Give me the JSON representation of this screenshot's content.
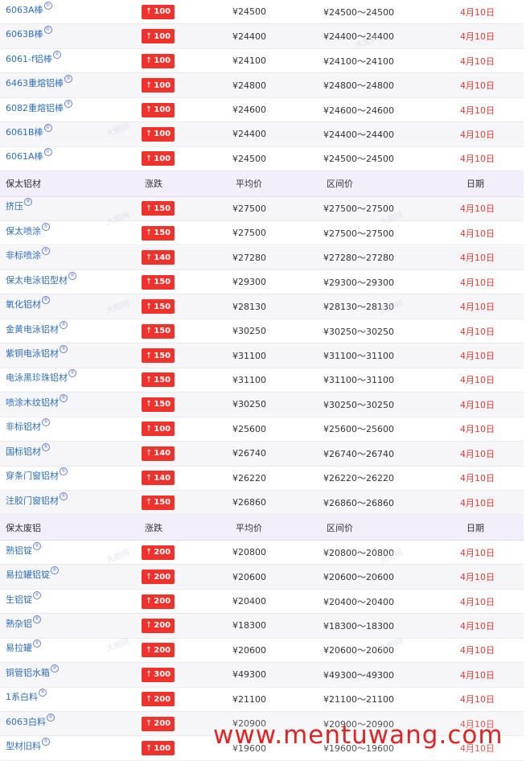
{
  "sections": [
    {
      "header": null,
      "rows": [
        {
          "name": "6063A棒",
          "change": "100",
          "avg": "¥24500",
          "range": "¥24500～24500",
          "date": "4月10日"
        },
        {
          "name": "6063B棒",
          "change": "100",
          "avg": "¥24400",
          "range": "¥24400～24400",
          "date": "4月10日"
        },
        {
          "name": "6061-f铝棒",
          "change": "100",
          "avg": "¥24100",
          "range": "¥24100～24100",
          "date": "4月10日"
        },
        {
          "name": "6463重熔铝棒",
          "change": "100",
          "avg": "¥24800",
          "range": "¥24800～24800",
          "date": "4月10日"
        },
        {
          "name": "6082重熔铝棒",
          "change": "100",
          "avg": "¥24600",
          "range": "¥24600～24600",
          "date": "4月10日"
        },
        {
          "name": "6061B棒",
          "change": "100",
          "avg": "¥24400",
          "range": "¥24400～24400",
          "date": "4月10日"
        },
        {
          "name": "6061A棒",
          "change": "100",
          "avg": "¥24500",
          "range": "¥24500～24500",
          "date": "4月10日"
        }
      ]
    },
    {
      "header": {
        "name": "保太铝材",
        "change": "涨跌",
        "avg": "平均价",
        "range": "区间价",
        "date": "日期"
      },
      "rows": [
        {
          "name": "挤压",
          "change": "150",
          "avg": "¥27500",
          "range": "¥27500～27500",
          "date": "4月10日"
        },
        {
          "name": "保太喷涂",
          "change": "150",
          "avg": "¥27500",
          "range": "¥27500～27500",
          "date": "4月10日"
        },
        {
          "name": "非标喷涂",
          "change": "140",
          "avg": "¥27280",
          "range": "¥27280～27280",
          "date": "4月10日"
        },
        {
          "name": "保太电泳铝型材",
          "change": "150",
          "avg": "¥29300",
          "range": "¥29300～29300",
          "date": "4月10日"
        },
        {
          "name": "氧化铝材",
          "change": "150",
          "avg": "¥28130",
          "range": "¥28130～28130",
          "date": "4月10日"
        },
        {
          "name": "金黄电泳铝材",
          "change": "150",
          "avg": "¥30250",
          "range": "¥30250～30250",
          "date": "4月10日"
        },
        {
          "name": "紫铜电泳铝材",
          "change": "150",
          "avg": "¥31100",
          "range": "¥31100～31100",
          "date": "4月10日"
        },
        {
          "name": "电泳黑珍珠铝材",
          "change": "150",
          "avg": "¥31100",
          "range": "¥31100～31100",
          "date": "4月10日"
        },
        {
          "name": "喷涂木纹铝材",
          "change": "150",
          "avg": "¥30250",
          "range": "¥30250～30250",
          "date": "4月10日"
        },
        {
          "name": "非标铝材",
          "change": "100",
          "avg": "¥25600",
          "range": "¥25600～25600",
          "date": "4月10日"
        },
        {
          "name": "国标铝材",
          "change": "140",
          "avg": "¥26740",
          "range": "¥26740～26740",
          "date": "4月10日"
        },
        {
          "name": "穿条门窗铝材",
          "change": "140",
          "avg": "¥26220",
          "range": "¥26220～26220",
          "date": "4月10日"
        },
        {
          "name": "注胶门窗铝材",
          "change": "150",
          "avg": "¥26860",
          "range": "¥26860～26860",
          "date": "4月10日"
        }
      ]
    },
    {
      "header": {
        "name": "保太废铝",
        "change": "涨跌",
        "avg": "平均价",
        "range": "区间价",
        "date": "日期"
      },
      "rows": [
        {
          "name": "熟铝锭",
          "change": "200",
          "avg": "¥20800",
          "range": "¥20800～20800",
          "date": "4月10日"
        },
        {
          "name": "易拉罐铝锭",
          "change": "200",
          "avg": "¥20600",
          "range": "¥20600～20600",
          "date": "4月10日"
        },
        {
          "name": "生铝锭",
          "change": "200",
          "avg": "¥20400",
          "range": "¥20400～20400",
          "date": "4月10日"
        },
        {
          "name": "熟杂铝",
          "change": "200",
          "avg": "¥18300",
          "range": "¥18300～18300",
          "date": "4月10日"
        },
        {
          "name": "易拉罐",
          "change": "200",
          "avg": "¥20600",
          "range": "¥20600～20600",
          "date": "4月10日"
        },
        {
          "name": "铜管铝水箱",
          "change": "300",
          "avg": "¥49300",
          "range": "¥49300～49300",
          "date": "4月10日"
        },
        {
          "name": "1系白料",
          "change": "200",
          "avg": "¥21100",
          "range": "¥21100～21100",
          "date": "4月10日"
        },
        {
          "name": "6063白料",
          "change": "200",
          "avg": "¥20900",
          "range": "¥20900～20900",
          "date": "4月10日"
        },
        {
          "name": "型材旧料",
          "change": "100",
          "avg": "¥19600",
          "range": "¥19600～19600",
          "date": "4月10日"
        }
      ]
    }
  ],
  "watermark_text": "大胆网",
  "footer_watermark": "www.mentuwang.com",
  "icons": {
    "up_arrow": "up-arrow-icon",
    "sup": "link-badge-icon"
  },
  "colors": {
    "accent_red": "#f0322c",
    "date_red": "#e23a34",
    "link_blue": "#2f6fb8",
    "header_bg": "#f2eefa"
  }
}
